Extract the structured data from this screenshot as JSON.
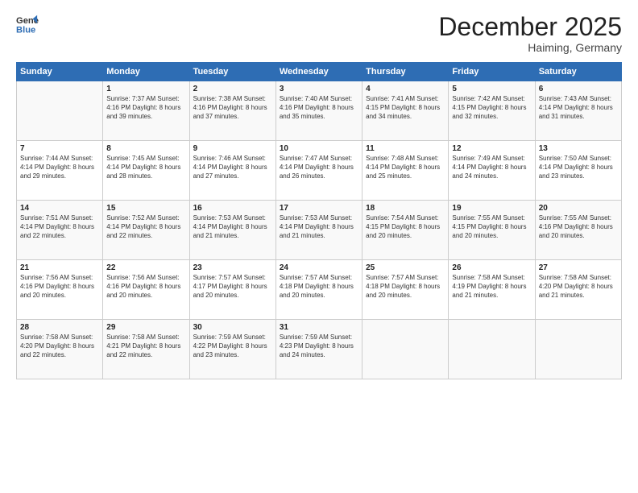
{
  "logo": {
    "general": "General",
    "blue": "Blue"
  },
  "header": {
    "month": "December 2025",
    "location": "Haiming, Germany"
  },
  "days_of_week": [
    "Sunday",
    "Monday",
    "Tuesday",
    "Wednesday",
    "Thursday",
    "Friday",
    "Saturday"
  ],
  "weeks": [
    [
      {
        "day": "",
        "info": ""
      },
      {
        "day": "1",
        "info": "Sunrise: 7:37 AM\nSunset: 4:16 PM\nDaylight: 8 hours\nand 39 minutes."
      },
      {
        "day": "2",
        "info": "Sunrise: 7:38 AM\nSunset: 4:16 PM\nDaylight: 8 hours\nand 37 minutes."
      },
      {
        "day": "3",
        "info": "Sunrise: 7:40 AM\nSunset: 4:16 PM\nDaylight: 8 hours\nand 35 minutes."
      },
      {
        "day": "4",
        "info": "Sunrise: 7:41 AM\nSunset: 4:15 PM\nDaylight: 8 hours\nand 34 minutes."
      },
      {
        "day": "5",
        "info": "Sunrise: 7:42 AM\nSunset: 4:15 PM\nDaylight: 8 hours\nand 32 minutes."
      },
      {
        "day": "6",
        "info": "Sunrise: 7:43 AM\nSunset: 4:14 PM\nDaylight: 8 hours\nand 31 minutes."
      }
    ],
    [
      {
        "day": "7",
        "info": "Sunrise: 7:44 AM\nSunset: 4:14 PM\nDaylight: 8 hours\nand 29 minutes."
      },
      {
        "day": "8",
        "info": "Sunrise: 7:45 AM\nSunset: 4:14 PM\nDaylight: 8 hours\nand 28 minutes."
      },
      {
        "day": "9",
        "info": "Sunrise: 7:46 AM\nSunset: 4:14 PM\nDaylight: 8 hours\nand 27 minutes."
      },
      {
        "day": "10",
        "info": "Sunrise: 7:47 AM\nSunset: 4:14 PM\nDaylight: 8 hours\nand 26 minutes."
      },
      {
        "day": "11",
        "info": "Sunrise: 7:48 AM\nSunset: 4:14 PM\nDaylight: 8 hours\nand 25 minutes."
      },
      {
        "day": "12",
        "info": "Sunrise: 7:49 AM\nSunset: 4:14 PM\nDaylight: 8 hours\nand 24 minutes."
      },
      {
        "day": "13",
        "info": "Sunrise: 7:50 AM\nSunset: 4:14 PM\nDaylight: 8 hours\nand 23 minutes."
      }
    ],
    [
      {
        "day": "14",
        "info": "Sunrise: 7:51 AM\nSunset: 4:14 PM\nDaylight: 8 hours\nand 22 minutes."
      },
      {
        "day": "15",
        "info": "Sunrise: 7:52 AM\nSunset: 4:14 PM\nDaylight: 8 hours\nand 22 minutes."
      },
      {
        "day": "16",
        "info": "Sunrise: 7:53 AM\nSunset: 4:14 PM\nDaylight: 8 hours\nand 21 minutes."
      },
      {
        "day": "17",
        "info": "Sunrise: 7:53 AM\nSunset: 4:14 PM\nDaylight: 8 hours\nand 21 minutes."
      },
      {
        "day": "18",
        "info": "Sunrise: 7:54 AM\nSunset: 4:15 PM\nDaylight: 8 hours\nand 20 minutes."
      },
      {
        "day": "19",
        "info": "Sunrise: 7:55 AM\nSunset: 4:15 PM\nDaylight: 8 hours\nand 20 minutes."
      },
      {
        "day": "20",
        "info": "Sunrise: 7:55 AM\nSunset: 4:16 PM\nDaylight: 8 hours\nand 20 minutes."
      }
    ],
    [
      {
        "day": "21",
        "info": "Sunrise: 7:56 AM\nSunset: 4:16 PM\nDaylight: 8 hours\nand 20 minutes."
      },
      {
        "day": "22",
        "info": "Sunrise: 7:56 AM\nSunset: 4:16 PM\nDaylight: 8 hours\nand 20 minutes."
      },
      {
        "day": "23",
        "info": "Sunrise: 7:57 AM\nSunset: 4:17 PM\nDaylight: 8 hours\nand 20 minutes."
      },
      {
        "day": "24",
        "info": "Sunrise: 7:57 AM\nSunset: 4:18 PM\nDaylight: 8 hours\nand 20 minutes."
      },
      {
        "day": "25",
        "info": "Sunrise: 7:57 AM\nSunset: 4:18 PM\nDaylight: 8 hours\nand 20 minutes."
      },
      {
        "day": "26",
        "info": "Sunrise: 7:58 AM\nSunset: 4:19 PM\nDaylight: 8 hours\nand 21 minutes."
      },
      {
        "day": "27",
        "info": "Sunrise: 7:58 AM\nSunset: 4:20 PM\nDaylight: 8 hours\nand 21 minutes."
      }
    ],
    [
      {
        "day": "28",
        "info": "Sunrise: 7:58 AM\nSunset: 4:20 PM\nDaylight: 8 hours\nand 22 minutes."
      },
      {
        "day": "29",
        "info": "Sunrise: 7:58 AM\nSunset: 4:21 PM\nDaylight: 8 hours\nand 22 minutes."
      },
      {
        "day": "30",
        "info": "Sunrise: 7:59 AM\nSunset: 4:22 PM\nDaylight: 8 hours\nand 23 minutes."
      },
      {
        "day": "31",
        "info": "Sunrise: 7:59 AM\nSunset: 4:23 PM\nDaylight: 8 hours\nand 24 minutes."
      },
      {
        "day": "",
        "info": ""
      },
      {
        "day": "",
        "info": ""
      },
      {
        "day": "",
        "info": ""
      }
    ]
  ]
}
